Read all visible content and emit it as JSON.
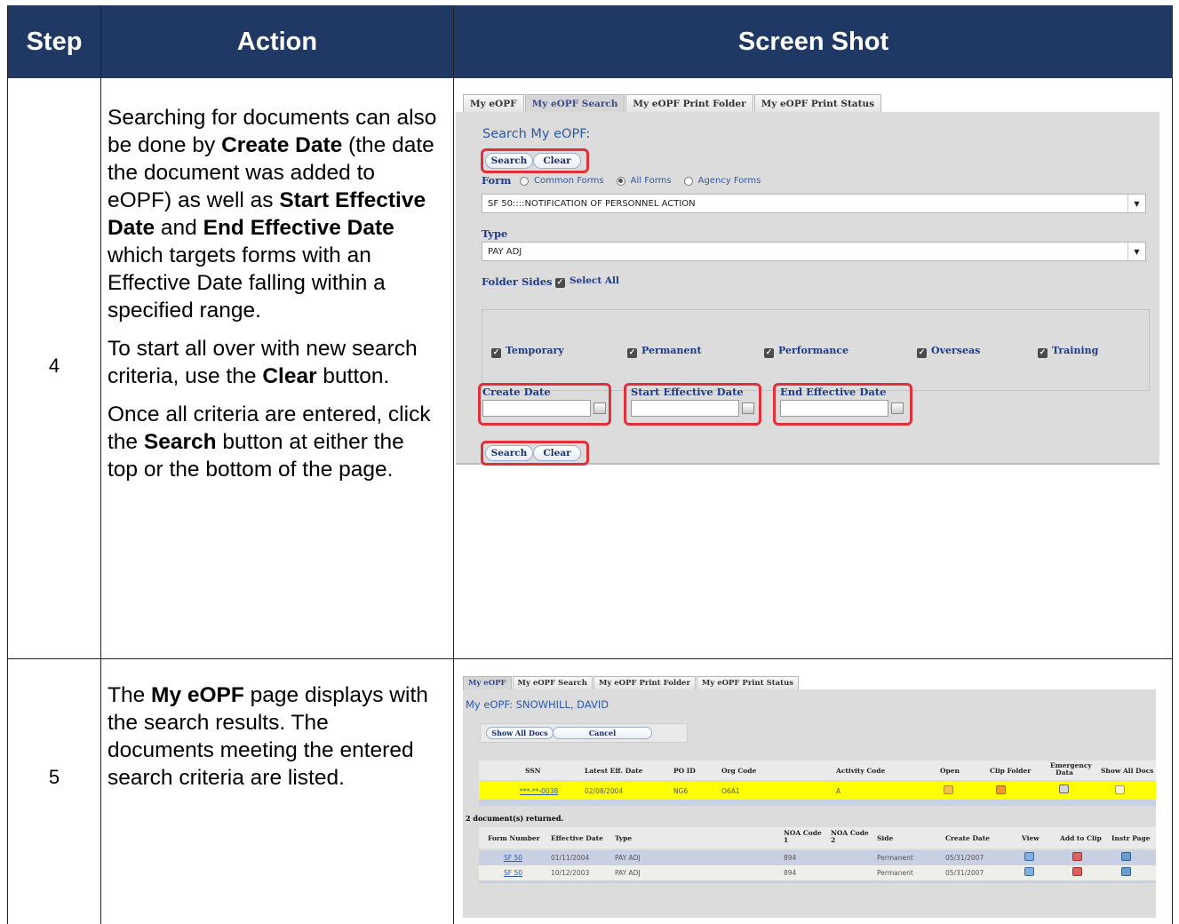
{
  "table": {
    "headers": [
      "Step",
      "Action",
      "Screen Shot"
    ],
    "colors": {
      "header_bg": "#1f3864",
      "header_text": "#ffffff",
      "highlight_box": "#e0303a"
    }
  },
  "row4": {
    "step": "4",
    "action_p1_parts": [
      "Searching for documents can also be done by ",
      "Create Date",
      " (the date the document was added to eOPF) as well as ",
      "Start Effective Date",
      " and ",
      "End Effective Date",
      " which targets forms with an Effective Date falling within a specified range."
    ],
    "action_p2_parts": [
      "To start all over with new search criteria, use the ",
      "Clear",
      " button."
    ],
    "action_p3_parts": [
      "Once all criteria are entered, click the ",
      "Search",
      " button at either the top or the bottom of the page."
    ],
    "screen": {
      "tabs": [
        "My eOPF",
        "My eOPF Search",
        "My eOPF Print Folder",
        "My eOPF Print Status"
      ],
      "active_tab": "My eOPF Search",
      "title": "Search My eOPF:",
      "search_label": "Search",
      "clear_label": "Clear",
      "form_label": "Form",
      "form_options": [
        "Common Forms",
        "All Forms",
        "Agency Forms"
      ],
      "form_selected": "All Forms",
      "form_value": "SF 50::::NOTIFICATION OF PERSONNEL ACTION",
      "type_label": "Type",
      "type_value": "PAY ADJ",
      "folder_sides_label": "Folder Sides",
      "select_all_label": "Select All",
      "sides": [
        "Temporary",
        "Permanent",
        "Performance",
        "Overseas",
        "Training"
      ],
      "create_date_label": "Create Date",
      "start_eff_label": "Start Effective Date",
      "end_eff_label": "End Effective Date",
      "dropdown_icon": "chevron-down-icon",
      "calendar_icon": "calendar-icon"
    }
  },
  "row5": {
    "step": "5",
    "action_parts": [
      "The ",
      "My eOPF",
      " page displays with the search results. The documents meeting the entered search criteria are listed."
    ],
    "screen": {
      "tabs": [
        "My eOPF",
        "My eOPF Search",
        "My eOPF Print Folder",
        "My eOPF Print Status"
      ],
      "active_tab": "My eOPF",
      "title": "My eOPF: SNOWHILL, DAVID",
      "show_all_docs": "Show All Docs",
      "cancel": "Cancel",
      "emp_headers": [
        "SSN",
        "Latest Eff. Date",
        "PO ID",
        "Org Code",
        "Activity Code",
        "Open",
        "Clip Folder",
        "Emergency Data",
        "Show All Docs"
      ],
      "emp_row": [
        "***-**-0038",
        "02/08/2004",
        "NG6",
        "O6A1",
        "A"
      ],
      "returned": "2 document(s) returned.",
      "doc_headers": [
        "Form Number",
        "Effective Date",
        "Type",
        "NOA Code 1",
        "NOA Code 2",
        "Side",
        "Create Date",
        "View",
        "Add to Clip",
        "Instr Page"
      ],
      "doc_rows": [
        [
          "SF 50",
          "01/11/2004",
          "PAY ADJ",
          "894",
          "",
          "Permanent",
          "05/31/2007"
        ],
        [
          "SF 50",
          "10/12/2003",
          "PAY ADJ",
          "894",
          "",
          "Permanent",
          "05/31/2007"
        ]
      ]
    }
  }
}
